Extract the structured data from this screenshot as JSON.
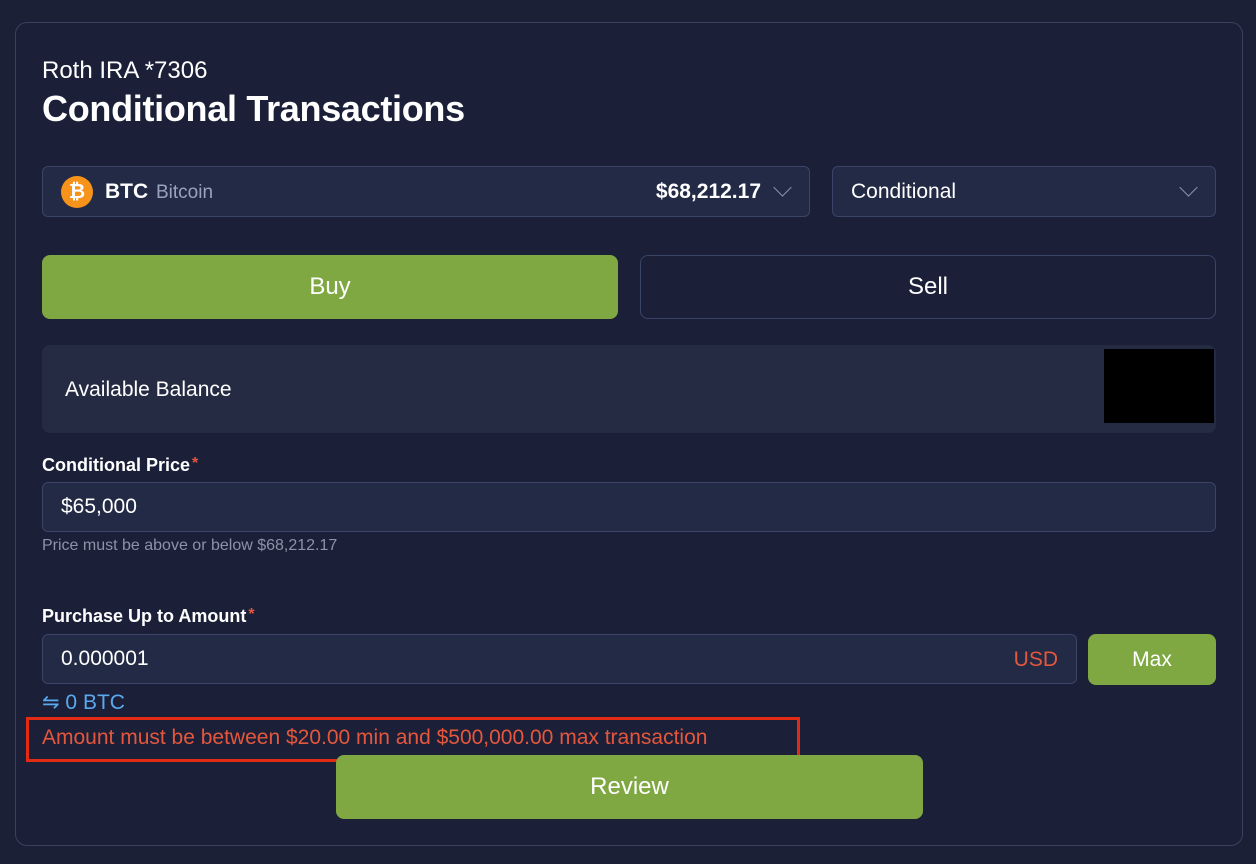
{
  "header": {
    "account": "Roth IRA *7306",
    "title": "Conditional Transactions"
  },
  "asset": {
    "icon": "bitcoin-icon",
    "icon_glyph": "₿",
    "icon_color": "#f7931a",
    "symbol": "BTC",
    "name": "Bitcoin",
    "price": "$68,212.17"
  },
  "order_type": {
    "selected": "Conditional"
  },
  "side": {
    "buy_label": "Buy",
    "sell_label": "Sell",
    "active": "Buy"
  },
  "balance": {
    "label": "Available Balance"
  },
  "conditional_price": {
    "label": "Conditional Price",
    "required": "*",
    "value": "$65,000",
    "hint": "Price must be above or below $68,212.17"
  },
  "amount": {
    "label": "Purchase Up to Amount",
    "required": "*",
    "value": "0.000001",
    "unit": "USD",
    "max_label": "Max",
    "conversion": "⇋ 0 BTC",
    "error": "Amount must be between $20.00 min and $500,000.00 max transaction"
  },
  "review_label": "Review",
  "colors": {
    "accent_green": "#7fa843",
    "error_red": "#e5573d",
    "link_blue": "#5aa9ee",
    "background": "#1b2036"
  }
}
